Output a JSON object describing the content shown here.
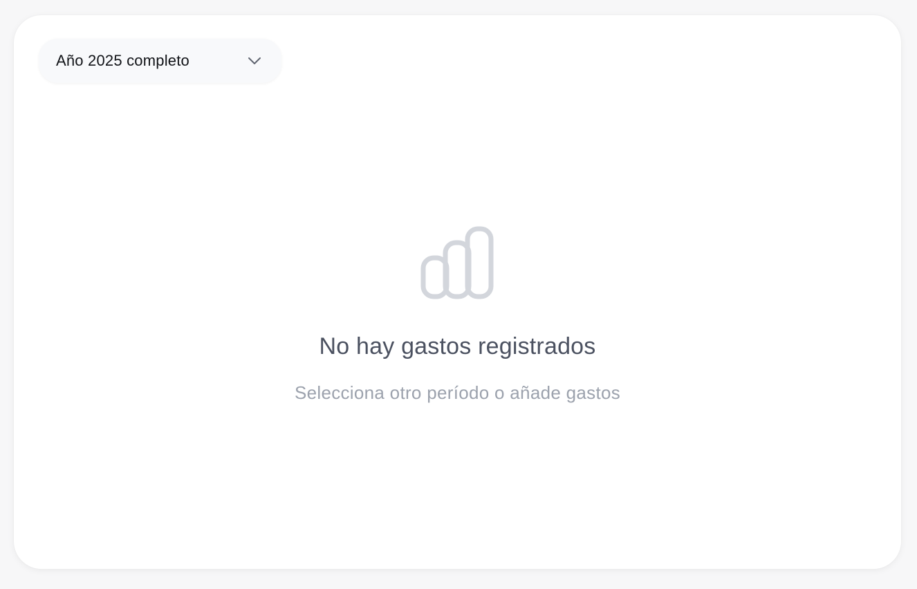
{
  "period_selector": {
    "selected": "Año 2025 completo",
    "chevron_icon": "chevron-down-icon"
  },
  "empty_state": {
    "icon": "bar-chart-icon",
    "title": "No hay gastos registrados",
    "subtitle": "Selecciona otro período o añade gastos"
  },
  "colors": {
    "background": "#f7f7f8",
    "card": "#ffffff",
    "title": "#4b5160",
    "subtitle": "#9ca2ad",
    "icon": "#d3d6dc"
  }
}
